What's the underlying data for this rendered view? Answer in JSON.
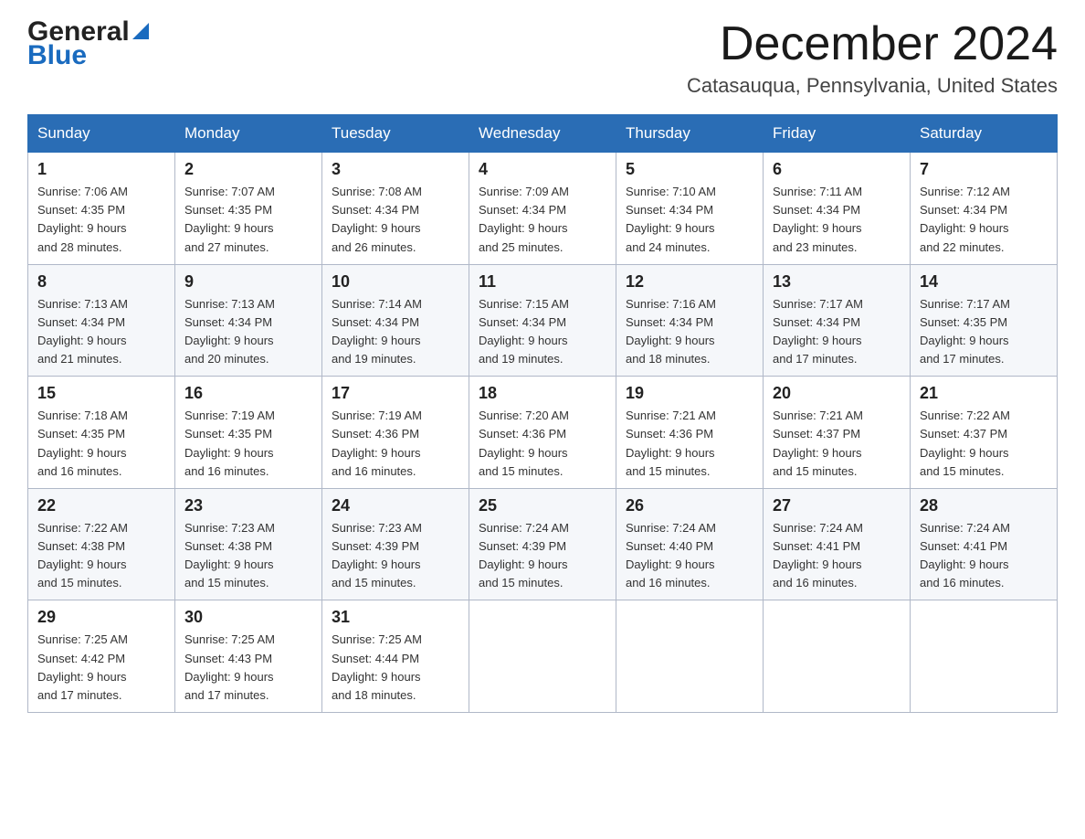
{
  "header": {
    "month_title": "December 2024",
    "location": "Catasauqua, Pennsylvania, United States",
    "logo_general": "General",
    "logo_blue": "Blue"
  },
  "days_of_week": [
    "Sunday",
    "Monday",
    "Tuesday",
    "Wednesday",
    "Thursday",
    "Friday",
    "Saturday"
  ],
  "weeks": [
    [
      {
        "day": "1",
        "sunrise": "7:06 AM",
        "sunset": "4:35 PM",
        "daylight": "9 hours and 28 minutes."
      },
      {
        "day": "2",
        "sunrise": "7:07 AM",
        "sunset": "4:35 PM",
        "daylight": "9 hours and 27 minutes."
      },
      {
        "day": "3",
        "sunrise": "7:08 AM",
        "sunset": "4:34 PM",
        "daylight": "9 hours and 26 minutes."
      },
      {
        "day": "4",
        "sunrise": "7:09 AM",
        "sunset": "4:34 PM",
        "daylight": "9 hours and 25 minutes."
      },
      {
        "day": "5",
        "sunrise": "7:10 AM",
        "sunset": "4:34 PM",
        "daylight": "9 hours and 24 minutes."
      },
      {
        "day": "6",
        "sunrise": "7:11 AM",
        "sunset": "4:34 PM",
        "daylight": "9 hours and 23 minutes."
      },
      {
        "day": "7",
        "sunrise": "7:12 AM",
        "sunset": "4:34 PM",
        "daylight": "9 hours and 22 minutes."
      }
    ],
    [
      {
        "day": "8",
        "sunrise": "7:13 AM",
        "sunset": "4:34 PM",
        "daylight": "9 hours and 21 minutes."
      },
      {
        "day": "9",
        "sunrise": "7:13 AM",
        "sunset": "4:34 PM",
        "daylight": "9 hours and 20 minutes."
      },
      {
        "day": "10",
        "sunrise": "7:14 AM",
        "sunset": "4:34 PM",
        "daylight": "9 hours and 19 minutes."
      },
      {
        "day": "11",
        "sunrise": "7:15 AM",
        "sunset": "4:34 PM",
        "daylight": "9 hours and 19 minutes."
      },
      {
        "day": "12",
        "sunrise": "7:16 AM",
        "sunset": "4:34 PM",
        "daylight": "9 hours and 18 minutes."
      },
      {
        "day": "13",
        "sunrise": "7:17 AM",
        "sunset": "4:34 PM",
        "daylight": "9 hours and 17 minutes."
      },
      {
        "day": "14",
        "sunrise": "7:17 AM",
        "sunset": "4:35 PM",
        "daylight": "9 hours and 17 minutes."
      }
    ],
    [
      {
        "day": "15",
        "sunrise": "7:18 AM",
        "sunset": "4:35 PM",
        "daylight": "9 hours and 16 minutes."
      },
      {
        "day": "16",
        "sunrise": "7:19 AM",
        "sunset": "4:35 PM",
        "daylight": "9 hours and 16 minutes."
      },
      {
        "day": "17",
        "sunrise": "7:19 AM",
        "sunset": "4:36 PM",
        "daylight": "9 hours and 16 minutes."
      },
      {
        "day": "18",
        "sunrise": "7:20 AM",
        "sunset": "4:36 PM",
        "daylight": "9 hours and 15 minutes."
      },
      {
        "day": "19",
        "sunrise": "7:21 AM",
        "sunset": "4:36 PM",
        "daylight": "9 hours and 15 minutes."
      },
      {
        "day": "20",
        "sunrise": "7:21 AM",
        "sunset": "4:37 PM",
        "daylight": "9 hours and 15 minutes."
      },
      {
        "day": "21",
        "sunrise": "7:22 AM",
        "sunset": "4:37 PM",
        "daylight": "9 hours and 15 minutes."
      }
    ],
    [
      {
        "day": "22",
        "sunrise": "7:22 AM",
        "sunset": "4:38 PM",
        "daylight": "9 hours and 15 minutes."
      },
      {
        "day": "23",
        "sunrise": "7:23 AM",
        "sunset": "4:38 PM",
        "daylight": "9 hours and 15 minutes."
      },
      {
        "day": "24",
        "sunrise": "7:23 AM",
        "sunset": "4:39 PM",
        "daylight": "9 hours and 15 minutes."
      },
      {
        "day": "25",
        "sunrise": "7:24 AM",
        "sunset": "4:39 PM",
        "daylight": "9 hours and 15 minutes."
      },
      {
        "day": "26",
        "sunrise": "7:24 AM",
        "sunset": "4:40 PM",
        "daylight": "9 hours and 16 minutes."
      },
      {
        "day": "27",
        "sunrise": "7:24 AM",
        "sunset": "4:41 PM",
        "daylight": "9 hours and 16 minutes."
      },
      {
        "day": "28",
        "sunrise": "7:24 AM",
        "sunset": "4:41 PM",
        "daylight": "9 hours and 16 minutes."
      }
    ],
    [
      {
        "day": "29",
        "sunrise": "7:25 AM",
        "sunset": "4:42 PM",
        "daylight": "9 hours and 17 minutes."
      },
      {
        "day": "30",
        "sunrise": "7:25 AM",
        "sunset": "4:43 PM",
        "daylight": "9 hours and 17 minutes."
      },
      {
        "day": "31",
        "sunrise": "7:25 AM",
        "sunset": "4:44 PM",
        "daylight": "9 hours and 18 minutes."
      },
      null,
      null,
      null,
      null
    ]
  ],
  "labels": {
    "sunrise_prefix": "Sunrise: ",
    "sunset_prefix": "Sunset: ",
    "daylight_prefix": "Daylight: "
  }
}
